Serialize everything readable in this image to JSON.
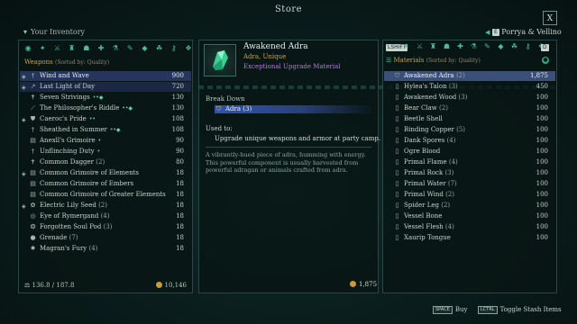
{
  "window": {
    "title": "Store",
    "close_label": "X"
  },
  "inventory": {
    "label": "Your Inventory"
  },
  "party": {
    "key_left": "◀",
    "key_e": "E",
    "name": "Porrya & Vellino"
  },
  "left": {
    "sort_title": "Weapons",
    "sort_sub": "(Sorted by: Quality)",
    "items": [
      {
        "name": "Wind and Wave",
        "value": "900",
        "icon": "sword-icon",
        "equipped": true,
        "dots": "",
        "style": "hl"
      },
      {
        "name": "Last Light of Day",
        "value": "720",
        "icon": "spear-icon",
        "equipped": true,
        "dots": "",
        "style": "hl2"
      },
      {
        "name": "Seven Strivings",
        "value": "130",
        "icon": "dagger-icon",
        "equipped": false,
        "dots": "••◆",
        "style": ""
      },
      {
        "name": "The Philosopher's Riddle",
        "value": "130",
        "icon": "wand-icon",
        "equipped": false,
        "dots": "••◆",
        "style": ""
      },
      {
        "name": "Caeroc's Pride",
        "value": "108",
        "icon": "shield-icon",
        "equipped": true,
        "dots": "••",
        "style": ""
      },
      {
        "name": "Sheathed in Summer",
        "value": "108",
        "icon": "sword-icon",
        "equipped": false,
        "dots": "••◆",
        "style": ""
      },
      {
        "name": "Anexll's Grimoire",
        "value": "90",
        "icon": "book-icon",
        "equipped": false,
        "dots": "•",
        "style": ""
      },
      {
        "name": "Unflinching Duty",
        "value": "90",
        "icon": "sword-icon",
        "equipped": false,
        "dots": "•",
        "style": ""
      },
      {
        "name": "Common Dagger",
        "count": "(2)",
        "value": "80",
        "icon": "dagger-icon",
        "equipped": false,
        "dots": "",
        "style": ""
      },
      {
        "name": "Common Grimoire of Elements",
        "value": "18",
        "icon": "book-icon",
        "equipped": true,
        "dots": "",
        "style": ""
      },
      {
        "name": "Common Grimoire of Embers",
        "value": "18",
        "icon": "book-icon",
        "equipped": false,
        "dots": "",
        "style": ""
      },
      {
        "name": "Common Grimoire of Greater Elements",
        "value": "18",
        "icon": "book-icon",
        "equipped": false,
        "dots": "",
        "style": ""
      },
      {
        "name": "Electric Lily Seed",
        "count": "(2)",
        "value": "18",
        "icon": "seed-icon",
        "equipped": true,
        "dots": "",
        "style": ""
      },
      {
        "name": "Eye of Rymergand",
        "count": "(4)",
        "value": "18",
        "icon": "orb-icon",
        "equipped": false,
        "dots": "",
        "style": ""
      },
      {
        "name": "Forgotten Soul Pod",
        "count": "(3)",
        "value": "18",
        "icon": "pod-icon",
        "equipped": false,
        "dots": "",
        "style": ""
      },
      {
        "name": "Grenade",
        "count": "(7)",
        "value": "18",
        "icon": "grenade-icon",
        "equipped": false,
        "dots": "",
        "style": ""
      },
      {
        "name": "Magran's Fury",
        "count": "(4)",
        "value": "18",
        "icon": "fire-icon",
        "equipped": false,
        "dots": "",
        "style": ""
      }
    ],
    "weight": "136.8 / 187.8",
    "gold": "10,146"
  },
  "detail": {
    "name": "Awakened Adra",
    "subtitle": "Adra, Unique",
    "category": "Exceptional Upgrade Material",
    "breakdown_label": "Break Down",
    "breakdown_item": "Adra (3)",
    "used_label": "Used to:",
    "used_text": "Upgrade unique weapons and armor at party camp.",
    "description": "A vibrantly-hued piece of adra, humming with energy. This powerful component is usually harvested from powerful adragan or animals crafted from adra.",
    "gold": "1,875"
  },
  "right": {
    "tab_left": "LSHIFT",
    "tab_right": "D",
    "sort_title": "Materials",
    "sort_sub": "(Sorted by: Quality)",
    "items": [
      {
        "name": "Awakened Adra",
        "count": "(2)",
        "value": "1,875",
        "style": "sel"
      },
      {
        "name": "Hylea's Talon",
        "count": "(3)",
        "value": "450",
        "style": ""
      },
      {
        "name": "Awakened Wood",
        "count": "(3)",
        "value": "100",
        "style": ""
      },
      {
        "name": "Bear Claw",
        "count": "(2)",
        "value": "100",
        "style": ""
      },
      {
        "name": "Beetle Shell",
        "count": "",
        "value": "100",
        "style": ""
      },
      {
        "name": "Binding Copper",
        "count": "(5)",
        "value": "100",
        "style": ""
      },
      {
        "name": "Dank Spores",
        "count": "(4)",
        "value": "100",
        "style": ""
      },
      {
        "name": "Ogre Blood",
        "count": "",
        "value": "100",
        "style": ""
      },
      {
        "name": "Primal Flame",
        "count": "(4)",
        "value": "100",
        "style": ""
      },
      {
        "name": "Primal Rock",
        "count": "(3)",
        "value": "100",
        "style": ""
      },
      {
        "name": "Primal Water",
        "count": "(7)",
        "value": "100",
        "style": ""
      },
      {
        "name": "Primal Wind",
        "count": "(2)",
        "value": "100",
        "style": ""
      },
      {
        "name": "Spider Leg",
        "count": "(2)",
        "value": "100",
        "style": ""
      },
      {
        "name": "Vessel Bone",
        "count": "",
        "value": "100",
        "style": ""
      },
      {
        "name": "Vessel Flesh",
        "count": "(4)",
        "value": "100",
        "style": ""
      },
      {
        "name": "Xaurip Tongue",
        "count": "",
        "value": "100",
        "style": ""
      }
    ]
  },
  "bottom": {
    "buy_key": "SPACE",
    "buy_label": "Buy",
    "toggle_key": "LCTRL",
    "toggle_label": "Toggle Stash Items"
  },
  "colors": {
    "accent": "#37c2a0",
    "gold": "#c8a24f",
    "highlight": "#26355e",
    "unique": "#b67ad9"
  }
}
